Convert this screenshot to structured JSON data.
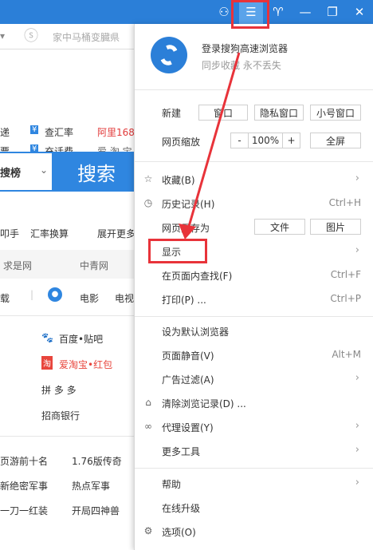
{
  "colors": {
    "titlebar": "#2b7fd8",
    "highlight": "#e8333a",
    "search_blue": "#2f86e0"
  },
  "titlebar": {
    "icons": [
      "user-icon",
      "menu-icon",
      "skin-icon",
      "minimize-icon",
      "restore-icon",
      "close-icon"
    ],
    "glyphs": {
      "user": "⚇",
      "menu": "☰",
      "skin": "♈",
      "minimize": "—",
      "restore": "❐",
      "close": "✕"
    }
  },
  "background": {
    "address_hint": "家中马桶变臓県",
    "links_row1": [
      "递",
      "查汇率",
      "阿里168"
    ],
    "links_row2": [
      "票",
      "充话费",
      "爱 淘 宝"
    ],
    "search_dropdown": "搜榜",
    "search_button": "搜索",
    "nav": [
      "叩手",
      "汇率换算",
      "展开更多"
    ],
    "sites": [
      "求是网",
      "中青网"
    ],
    "row_items": [
      "载",
      "电影",
      "电视"
    ],
    "shortcuts": [
      "百度•贴吧",
      "爱淘宝•红包",
      "拼 多 多",
      "招商银行"
    ],
    "hot_left": [
      "页游前十名",
      "新绝密军事",
      "一刀一红装"
    ],
    "hot_right": [
      "1.76版传奇",
      "热点军事",
      "开局四神兽"
    ]
  },
  "menu": {
    "login_title": "登录搜狗高速浏览器",
    "login_sub": "同步收藏 永不丢失",
    "new_label": "新建",
    "new_window": "窗口",
    "private_window": "隐私窗口",
    "small_window": "小号窗口",
    "zoom_label": "网页缩放",
    "zoom_minus": "-",
    "zoom_value": "100%",
    "zoom_plus": "+",
    "fullscreen": "全屏",
    "favorites": "收藏(B)",
    "history": "历史记录(H)",
    "history_sc": "Ctrl+H",
    "saveas": "网页另存为",
    "saveas_file": "文件",
    "saveas_image": "图片",
    "display": "显示",
    "find": "在页面内查找(F)",
    "find_sc": "Ctrl+F",
    "print": "打印(P) ...",
    "print_sc": "Ctrl+P",
    "default_browser": "设为默认浏览器",
    "mute": "页面静音(V)",
    "mute_sc": "Alt+M",
    "adfilter": "广告过滤(A)",
    "clear": "清除浏览记录(D) ...",
    "proxy": "代理设置(Y)",
    "more_tools": "更多工具",
    "help": "帮助",
    "upgrade": "在线升级",
    "options": "选项(O)"
  }
}
